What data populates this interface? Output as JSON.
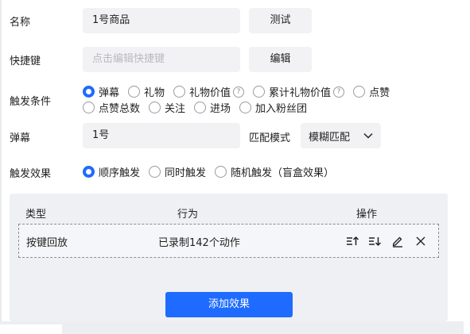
{
  "form": {
    "name": {
      "label": "名称",
      "value": "1号商品",
      "test_button": "测试"
    },
    "hotkey": {
      "label": "快捷键",
      "placeholder": "点击编辑快捷键",
      "edit_button": "编辑"
    },
    "trigger_condition": {
      "label": "触发条件",
      "options_row1": [
        {
          "label": "弹幕",
          "checked": true,
          "help": false
        },
        {
          "label": "礼物",
          "checked": false,
          "help": false
        },
        {
          "label": "礼物价值",
          "checked": false,
          "help": true
        },
        {
          "label": "累计礼物价值",
          "checked": false,
          "help": true
        },
        {
          "label": "点赞",
          "checked": false,
          "help": false
        }
      ],
      "options_row2": [
        {
          "label": "点赞总数",
          "checked": false
        },
        {
          "label": "关注",
          "checked": false
        },
        {
          "label": "进场",
          "checked": false
        },
        {
          "label": "加入粉丝团",
          "checked": false
        }
      ]
    },
    "danmaku": {
      "label": "弹幕",
      "value": "1号",
      "match_mode_label": "匹配模式",
      "match_mode_value": "模糊匹配"
    },
    "trigger_effect": {
      "label": "触发效果",
      "options": [
        {
          "label": "顺序触发",
          "checked": true
        },
        {
          "label": "同时触发",
          "checked": false
        },
        {
          "label": "随机触发（盲盒效果）",
          "checked": false
        }
      ]
    }
  },
  "effects_table": {
    "headers": {
      "type": "类型",
      "action": "行为",
      "ops": "操作"
    },
    "rows": [
      {
        "type": "按键回放",
        "action": "已录制142个动作"
      }
    ],
    "row_ops": [
      "move-up-icon",
      "move-down-icon",
      "edit-icon",
      "delete-icon"
    ],
    "add_button": "添加效果"
  },
  "colors": {
    "accent": "#1f6bff",
    "field_bg": "#f2f2f5",
    "panel_bg": "#eef0f4"
  }
}
